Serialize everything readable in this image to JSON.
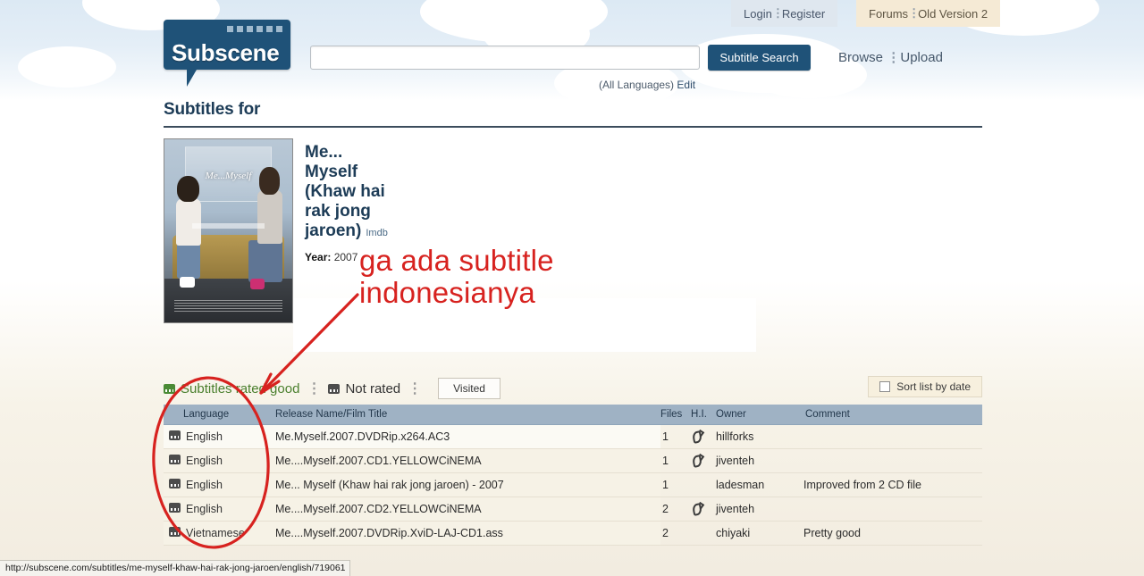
{
  "header": {
    "logo_text": "Subscene",
    "account_nav": {
      "login": "Login",
      "register": "Register",
      "separator": "⋮"
    },
    "site_nav": {
      "forums": "Forums",
      "old_version": "Old Version 2",
      "separator": "⋮"
    },
    "search": {
      "value": "",
      "placeholder": "",
      "button_label": "Subtitle Search"
    },
    "language_note": "(All Languages)",
    "language_edit": "Edit",
    "browse": "Browse",
    "upload": "Upload",
    "nav_separator": "⋮"
  },
  "page": {
    "title": "Subtitles for"
  },
  "movie": {
    "title": "Me... Myself (Khaw hai rak jong jaroen)",
    "imdb_label": "Imdb",
    "year_label": "Year:",
    "year_value": "2007",
    "poster_title": "Me...Myself"
  },
  "filters": {
    "rated_good": "Subtitles rated good",
    "not_rated": "Not rated",
    "visited": "Visited",
    "separator": "⋮",
    "sort_by_date": "Sort list by date"
  },
  "table": {
    "columns": {
      "language": "Language",
      "release": "Release Name/Film Title",
      "files": "Files",
      "hi": "H.I.",
      "owner": "Owner",
      "comment": "Comment"
    },
    "rows": [
      {
        "language": "English",
        "release": "Me.Myself.2007.DVDRip.x264.AC3",
        "files": "1",
        "hi": true,
        "owner": "hillforks",
        "comment": ""
      },
      {
        "language": "English",
        "release": "Me....Myself.2007.CD1.YELLOWCiNEMA",
        "files": "1",
        "hi": true,
        "owner": "jiventeh",
        "comment": ""
      },
      {
        "language": "English",
        "release": "Me... Myself (Khaw hai rak jong jaroen) - 2007",
        "files": "1",
        "hi": false,
        "owner": "ladesman",
        "comment": "Improved from 2 CD file"
      },
      {
        "language": "English",
        "release": "Me....Myself.2007.CD2.YELLOWCiNEMA",
        "files": "2",
        "hi": true,
        "owner": "jiventeh",
        "comment": ""
      },
      {
        "language": "Vietnamese",
        "release": "Me....Myself.2007.DVDRip.XviD-LAJ-CD1.ass",
        "files": "2",
        "hi": false,
        "owner": "chiyaki",
        "comment": "Pretty good"
      }
    ]
  },
  "annotation": {
    "line1": "ga ada subtitle",
    "line2": "indonesianya",
    "color": "#d7221f"
  },
  "statusbar": {
    "url": "http://subscene.com/subtitles/me-myself-khaw-hai-rak-jong-jaroen/english/719061"
  },
  "colors": {
    "brand_blue": "#1f5278",
    "header_bar": "#9fb2c4",
    "rated_good_green": "#4a7f2d",
    "annotation_red": "#d7221f"
  }
}
